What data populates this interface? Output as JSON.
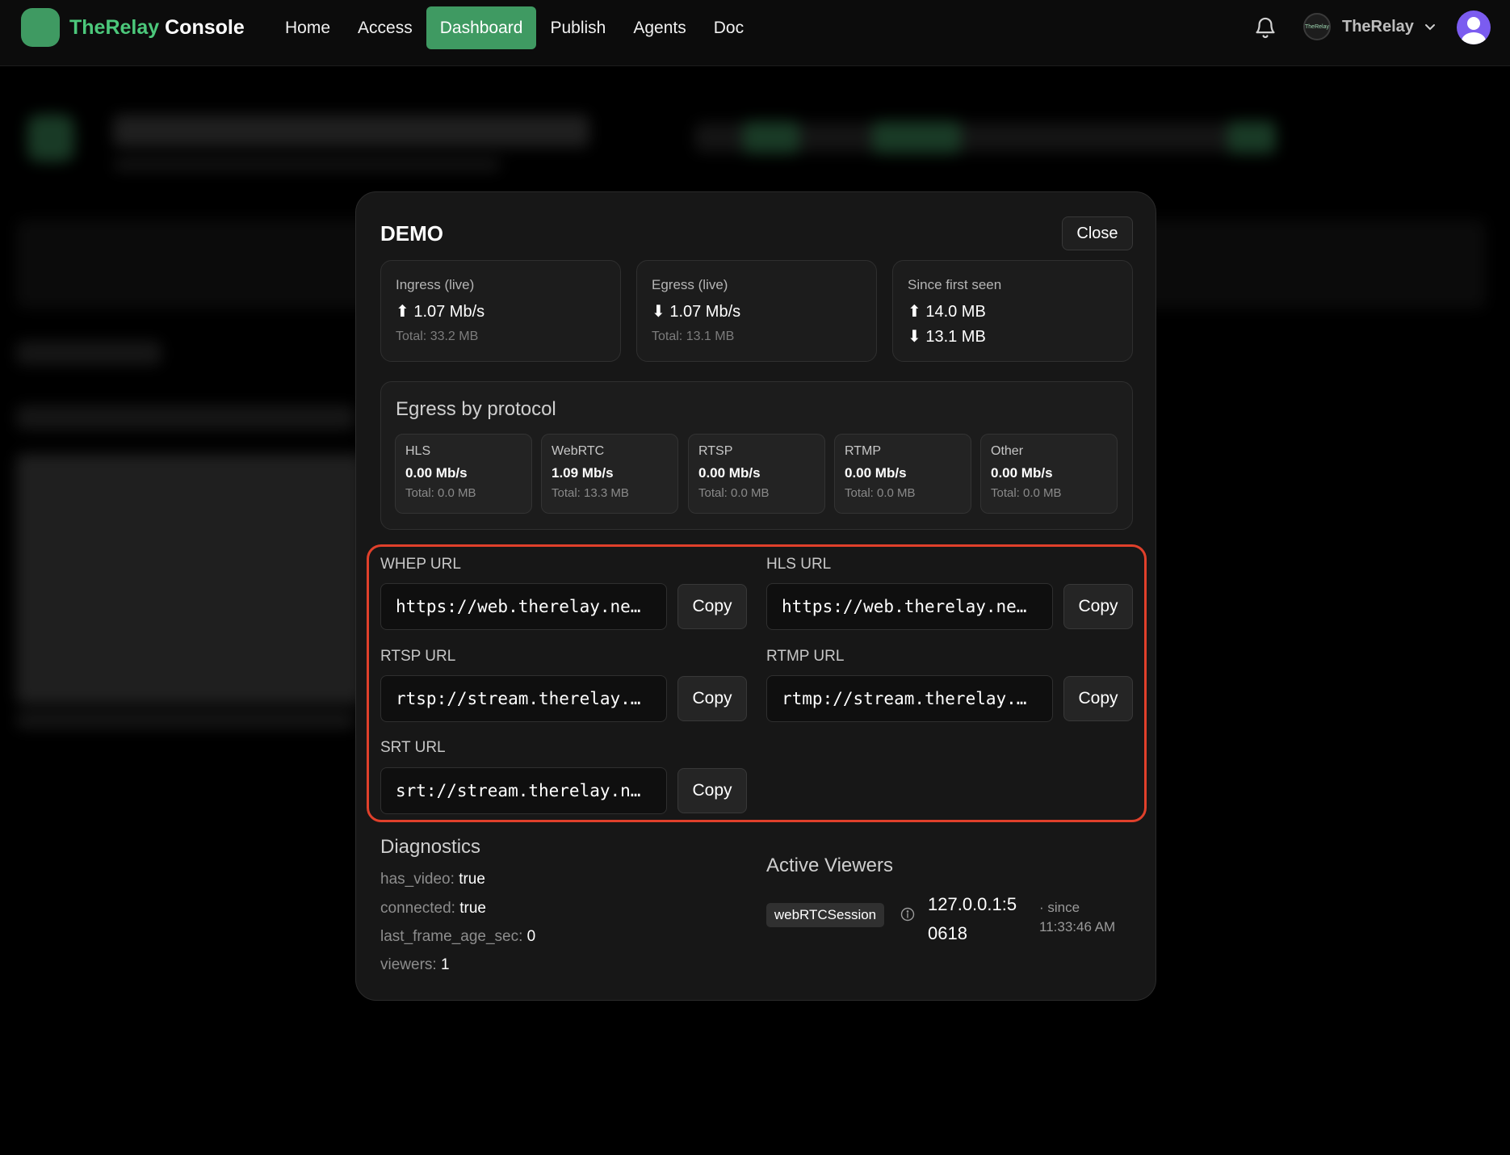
{
  "brand": {
    "name_accent": "TheRelay",
    "name_rest": "Console"
  },
  "nav": {
    "items": [
      "Home",
      "Access",
      "Dashboard",
      "Publish",
      "Agents",
      "Doc"
    ],
    "active_index": 2
  },
  "account": {
    "name": "TheRelay",
    "logo_text": "TheRelay"
  },
  "modal": {
    "title": "DEMO",
    "close_label": "Close",
    "ingress": {
      "label": "Ingress (live)",
      "rate": "1.07 Mb/s",
      "total": "Total: 33.2 MB"
    },
    "egress": {
      "label": "Egress (live)",
      "rate": "1.07 Mb/s",
      "total": "Total: 13.1 MB"
    },
    "since_first_seen": {
      "label": "Since first seen",
      "up": "14.0 MB",
      "down": "13.1 MB"
    },
    "egress_by_protocol": {
      "title": "Egress by protocol",
      "protocols": [
        {
          "name": "HLS",
          "rate": "0.00 Mb/s",
          "total": "Total: 0.0 MB"
        },
        {
          "name": "WebRTC",
          "rate": "1.09 Mb/s",
          "total": "Total: 13.3 MB"
        },
        {
          "name": "RTSP",
          "rate": "0.00 Mb/s",
          "total": "Total: 0.0 MB"
        },
        {
          "name": "RTMP",
          "rate": "0.00 Mb/s",
          "total": "Total: 0.0 MB"
        },
        {
          "name": "Other",
          "rate": "0.00 Mb/s",
          "total": "Total: 0.0 MB"
        }
      ]
    },
    "urls": {
      "copy_label": "Copy",
      "whep": {
        "label": "WHEP URL",
        "value": "https://web.therelay.ne…"
      },
      "hls": {
        "label": "HLS URL",
        "value": "https://web.therelay.ne…"
      },
      "rtsp": {
        "label": "RTSP URL",
        "value": "rtsp://stream.therelay.…"
      },
      "rtmp": {
        "label": "RTMP URL",
        "value": "rtmp://stream.therelay.…"
      },
      "srt": {
        "label": "SRT URL",
        "value": "srt://stream.therelay.n…"
      }
    },
    "diagnostics": {
      "title": "Diagnostics",
      "rows": [
        {
          "key": "has_video:",
          "value": "true"
        },
        {
          "key": "connected:",
          "value": "true"
        },
        {
          "key": "last_frame_age_sec:",
          "value": "0"
        },
        {
          "key": "viewers:",
          "value": "1"
        }
      ]
    },
    "active_viewers": {
      "title": "Active Viewers",
      "items": [
        {
          "type": "webRTCSession",
          "address": "127.0.0.1:50618",
          "since": "· since 11:33:46 AM"
        }
      ]
    }
  },
  "colors": {
    "accent": "#3f9a62",
    "brand_green": "#4cc87b",
    "highlight": "#e0402b",
    "avatar": "#7b5cf0"
  }
}
